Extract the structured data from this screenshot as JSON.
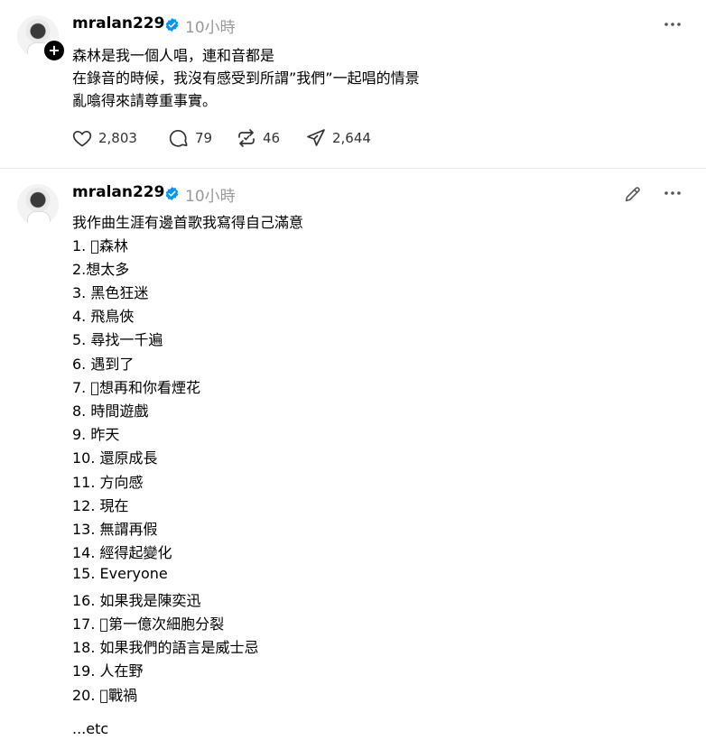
{
  "posts": [
    {
      "username": "mralan229",
      "time": "10小時",
      "lines": [
        "森林是我一個人唱，連和音都是",
        "在錄音的時候，我沒有感受到所謂”我們”一起唱的情景",
        "亂噏得來請尊重事實。"
      ],
      "stats": {
        "likes": "2,803",
        "replies": "79",
        "reposts": "46",
        "shares": "2,644"
      }
    },
    {
      "username": "mralan229",
      "time": "10小時",
      "lines": [
        "我作曲生涯有邊首歌我寫得自己滿意",
        "1. 􀀀森林",
        "2.想太多",
        "3. 黑色狂迷",
        "4. 飛鳥俠",
        "5. 尋找一千遍",
        "6. 遇到了",
        "7. 􀀀想再和你看煙花",
        "8. 時間遊戲",
        "9. 昨天",
        "10. 還原成長",
        "11. 方向感",
        "12. 現在",
        "13. 無謂再假",
        "14. 經得起變化",
        "15. Everyone",
        "16. 如果我是陳奕迅",
        "17. 􀀀第一億次細胞分裂",
        "18. 如果我們的語言是威士忌",
        "19. 人在野",
        "20. 􀀀戰禍",
        "",
        "...etc"
      ]
    }
  ],
  "colors": {
    "verified": "#0095f6",
    "muted": "#999999",
    "divider": "#e6e6e6"
  },
  "icons": [
    "heart-icon",
    "comment-icon",
    "repost-icon",
    "share-icon",
    "more-icon",
    "edit-icon",
    "verified-icon",
    "follow-plus-icon"
  ]
}
